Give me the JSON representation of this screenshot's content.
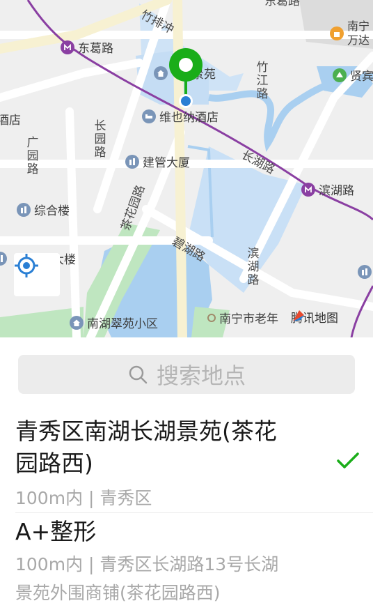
{
  "map": {
    "roads": {
      "zhupaichong": "竹排冲",
      "donggelu": "东葛路",
      "zhujianglu": "竹江路",
      "changhulu": "长湖路",
      "changyuanlu": "长园路",
      "guangyuanlu": "广园路",
      "chahuayuanlu": "茶花园路",
      "bihulu": "碧湖路",
      "binhulu": "滨湖路",
      "donggelu_top": "东葛路"
    },
    "pois": {
      "donggelu_metro": "东葛路",
      "binhulu_metro": "滨湖路",
      "jingyuan": "景苑",
      "weiyena": "维也纳酒店",
      "jianguan": "建管大厦",
      "zonghelou": "综合楼",
      "nanhu_cuiyuan": "南湖翠苑小区",
      "laonian": "南宁市老年",
      "hotel_left": "酒店",
      "dalou": "大楼",
      "wanda": "南宁万达",
      "xianbin": "贤宾"
    },
    "brand": "腾讯地图"
  },
  "search": {
    "placeholder": "搜索地点"
  },
  "results": [
    {
      "title_line1": "青秀区南湖长湖景苑(茶花",
      "title_line2": "园路西)",
      "subtitle": "100m内 | 青秀区",
      "selected": true
    },
    {
      "title_line1": "A+整形",
      "subtitle_line1": "100m内 | 青秀区长湖路13号长湖",
      "subtitle_line2": "景苑外围商铺(茶花园路西)",
      "selected": false
    }
  ],
  "colors": {
    "accent_green": "#1aad19",
    "metro_purple": "#8a3fa2",
    "water_blue": "#a9cff0",
    "park_green": "#bfe6c0"
  }
}
